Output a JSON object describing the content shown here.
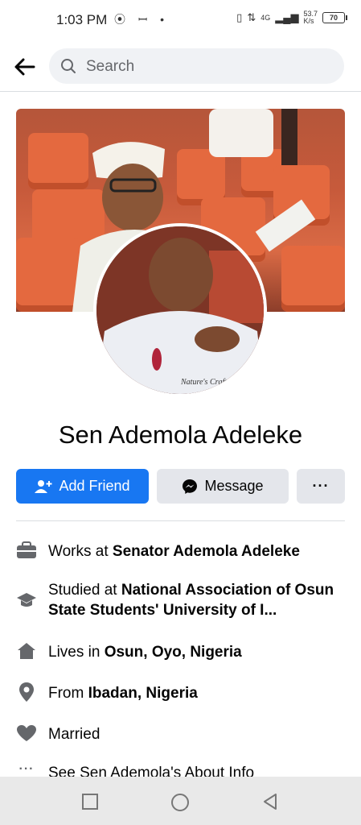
{
  "status_bar": {
    "time": "1:03 PM",
    "network_type": "4G",
    "speed_value": "53.7",
    "speed_unit": "K/s",
    "battery": "70"
  },
  "header": {
    "search_placeholder": "Search"
  },
  "profile": {
    "name": "Sen Ademola Adeleke",
    "cover_watermark": "Nature's Craft Inc"
  },
  "actions": {
    "add_friend": "Add Friend",
    "message": "Message",
    "more": "···"
  },
  "info": {
    "work_prefix": "Works at ",
    "work_value": "Senator Ademola Adeleke",
    "study_prefix": "Studied at ",
    "study_value": "National Association of Osun State Students' University of I...",
    "lives_prefix": "Lives in ",
    "lives_value": "Osun, Oyo, Nigeria",
    "from_prefix": "From ",
    "from_value": "Ibadan, Nigeria",
    "relationship": "Married",
    "see_about": "See Sen Ademola's About Info"
  },
  "icons": {
    "back": "arrow-left-icon",
    "search": "search-icon",
    "work": "briefcase-icon",
    "study": "graduation-cap-icon",
    "lives": "home-icon",
    "from": "location-pin-icon",
    "relationship": "heart-icon",
    "more_info": "ellipsis-icon"
  },
  "colors": {
    "primary": "#1877f2",
    "secondary_button": "#e4e6eb",
    "icon_gray": "#65676b"
  }
}
